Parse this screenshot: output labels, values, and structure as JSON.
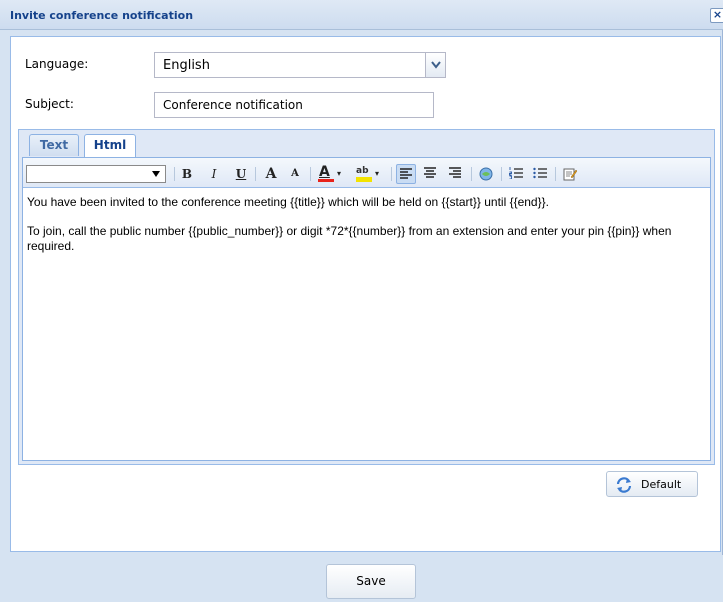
{
  "window": {
    "title": "Invite conference notification",
    "close_glyph": "×"
  },
  "form": {
    "language_label": "Language:",
    "language_value": "English",
    "subject_label": "Subject:",
    "subject_value": "Conference notification"
  },
  "tabs": [
    {
      "label": "Text",
      "active": false
    },
    {
      "label": "Html",
      "active": true
    }
  ],
  "toolbar": {
    "font_family_value": "",
    "buttons": [
      {
        "name": "bold-icon",
        "glyph": "B"
      },
      {
        "name": "italic-icon",
        "glyph": "I"
      },
      {
        "name": "underline-icon",
        "glyph": "U"
      },
      {
        "name": "grow-font-icon",
        "glyph": "A"
      },
      {
        "name": "shrink-font-icon",
        "glyph": "A"
      },
      {
        "name": "font-color-icon",
        "glyph": "A"
      },
      {
        "name": "highlight-color-icon",
        "glyph": "ab"
      },
      {
        "name": "align-left-icon",
        "active": true
      },
      {
        "name": "align-center-icon"
      },
      {
        "name": "align-right-icon"
      },
      {
        "name": "insert-link-icon"
      },
      {
        "name": "ordered-list-icon"
      },
      {
        "name": "unordered-list-icon"
      },
      {
        "name": "source-edit-icon"
      }
    ],
    "colors": {
      "font_color": "#e8231b",
      "highlight_color": "#f3e300"
    }
  },
  "editor": {
    "paragraphs": [
      "You have been invited to the conference meeting {{title}} which will be held on {{start}} until {{end}}.",
      "To join, call the public number {{public_number}} or digit *72*{{number}} from an extension and enter your pin {{pin}} when required."
    ]
  },
  "buttons": {
    "default_label": "Default",
    "save_label": "Save"
  },
  "colors": {
    "title_text": "#15428b",
    "panel_border": "#99bbe8",
    "window_bg": "#d6e3f2"
  }
}
